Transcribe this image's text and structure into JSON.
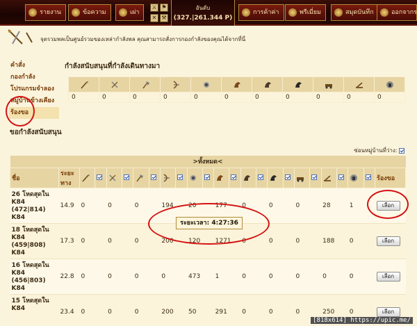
{
  "topbar": {
    "buttons": [
      "รายงาน",
      "ข้อความ",
      "เผ่า"
    ],
    "rank_label": "อันดับ",
    "rank_value": "(327.|261.344 P)",
    "right_buttons": [
      "การค้าค่า",
      "พรีเมี่ยม",
      "สมุดบันทึก",
      "ออกจากระ"
    ]
  },
  "header": {
    "description": "จุดรวมพลเป็นศูนย์รวมของเหล่ากำลังพล คุณสามารถสั่งการกองกำลังของคุณได้จากที่นี่"
  },
  "menu": {
    "items": [
      "คำสั่ง",
      "กองกำลัง",
      "โปรแกรมจำลอง",
      "หมู่บ้านข้างเคียง",
      "ร้องขอ"
    ]
  },
  "support": {
    "title": "กำลังสนับสนุนที่กำลังเดินทางมา",
    "units": [
      "spear-icon",
      "sword-icon",
      "axe-icon",
      "archer-icon",
      "scout-icon",
      "light-cavalry-icon",
      "mounted-archer-icon",
      "heavy-cavalry-icon",
      "ram-icon",
      "catapult-icon",
      "paladin-icon"
    ],
    "values": [
      "0",
      "0",
      "0",
      "0",
      "0",
      "0",
      "0",
      "0",
      "0",
      "0",
      "0"
    ]
  },
  "request": {
    "title": "ขอกำลังสนับสนุน",
    "hide_label": "ซ่อนหมู่บ้านที่ว่าง:",
    "all_label": ">ทั้งหมด<",
    "col_name": "ชื่อ",
    "col_distance": "ระยะทาง",
    "col_request": "ร้องขอ",
    "select_label": "เลือก",
    "timer_label": "ระยะเวลา:",
    "timer_value": "4:27:36",
    "rows": [
      {
        "line1": "26 โหดสุดใน",
        "line2": "K84",
        "line3": "(472|814)",
        "line4": "K84",
        "distance": "14.9",
        "cells": [
          "0",
          "0",
          "0",
          "194",
          "20",
          "177",
          "0",
          "0",
          "0",
          "28",
          "1"
        ]
      },
      {
        "line1": "18 โหดสุดใน",
        "line2": "K84",
        "line3": "(459|808)",
        "line4": "K84",
        "distance": "17.3",
        "cells": [
          "0",
          "0",
          "0",
          "200",
          "120",
          "1271",
          "0",
          "0",
          "0",
          "188",
          "0"
        ]
      },
      {
        "line1": "16 โหดสุดใน",
        "line2": "K84",
        "line3": "(456|803)",
        "line4": "K84",
        "distance": "22.8",
        "cells": [
          "0",
          "0",
          "0",
          "0",
          "473",
          "1",
          "0",
          "0",
          "0",
          "0",
          "0"
        ]
      },
      {
        "line1": "15 โหดสุดใน",
        "line2": "K84",
        "line3": "",
        "line4": "",
        "distance": "23.4",
        "cells": [
          "0",
          "0",
          "0",
          "200",
          "50",
          "291",
          "0",
          "0",
          "0",
          "250",
          "0"
        ]
      }
    ]
  },
  "watermark": "[818x614] https://upic.me/"
}
